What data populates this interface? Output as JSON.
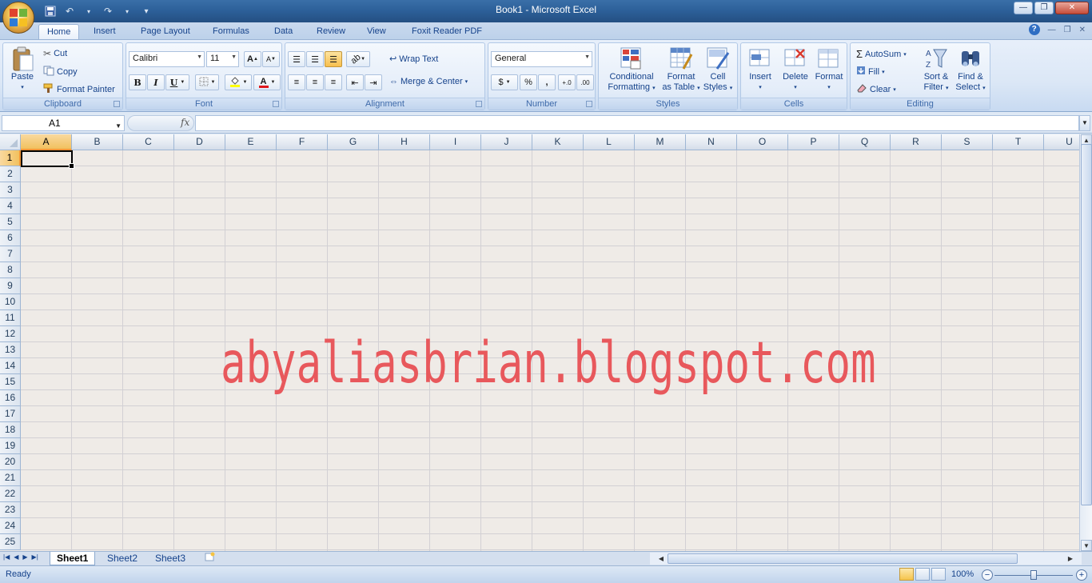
{
  "window": {
    "title": "Book1 - Microsoft Excel",
    "buttons": {
      "minimize": "—",
      "restore": "❐",
      "close": "✕"
    }
  },
  "qat": {
    "save_icon": "save-icon",
    "undo_icon": "undo-icon",
    "redo_icon": "redo-icon",
    "more": "▾"
  },
  "ribbon_tabs": [
    "Home",
    "Insert",
    "Page Layout",
    "Formulas",
    "Data",
    "Review",
    "View",
    "Foxit Reader PDF"
  ],
  "active_tab": "Home",
  "clipboard": {
    "paste": "Paste",
    "cut": "Cut",
    "copy": "Copy",
    "format_painter": "Format Painter",
    "label": "Clipboard"
  },
  "font": {
    "name": "Calibri",
    "size": "11",
    "bold": "B",
    "italic": "I",
    "underline": "U",
    "grow": "A",
    "shrink": "A",
    "font_color_glyph": "A",
    "label": "Font"
  },
  "alignment": {
    "wrap_text": "Wrap Text",
    "merge_center": "Merge & Center",
    "label": "Alignment"
  },
  "number": {
    "format": "General",
    "percent": "%",
    "comma": ",",
    "inc_decimal": "+.0\n.00",
    "dec_decimal": ".00\n→.0",
    "label": "Number"
  },
  "styles": {
    "conditional_formatting_1": "Conditional",
    "conditional_formatting_2": "Formatting",
    "format_table_1": "Format",
    "format_table_2": "as Table",
    "cell_styles_1": "Cell",
    "cell_styles_2": "Styles",
    "label": "Styles"
  },
  "cells": {
    "insert": "Insert",
    "delete": "Delete",
    "format": "Format",
    "label": "Cells"
  },
  "editing": {
    "autosum": "AutoSum",
    "fill": "Fill",
    "clear": "Clear",
    "sort_1": "Sort &",
    "sort_2": "Filter",
    "find_1": "Find &",
    "find_2": "Select",
    "label": "Editing"
  },
  "formula_bar": {
    "name_box": "A1",
    "fx": "fx",
    "value": ""
  },
  "columns": [
    "A",
    "B",
    "C",
    "D",
    "E",
    "F",
    "G",
    "H",
    "I",
    "J",
    "K",
    "L",
    "M",
    "N",
    "O",
    "P",
    "Q",
    "R",
    "S",
    "T",
    "U"
  ],
  "rows": [
    "1",
    "2",
    "3",
    "4",
    "5",
    "6",
    "7",
    "8",
    "9",
    "10",
    "11",
    "12",
    "13",
    "14",
    "15",
    "16",
    "17",
    "18",
    "19",
    "20",
    "21",
    "22",
    "23",
    "24",
    "25"
  ],
  "active_cell": {
    "col": "A",
    "row": "1"
  },
  "watermark": "abyaliasbrian.blogspot.com",
  "sheets": [
    "Sheet1",
    "Sheet2",
    "Sheet3"
  ],
  "active_sheet": "Sheet1",
  "status": {
    "text": "Ready",
    "zoom": "100%"
  },
  "colors": {
    "accent": "#15428b",
    "watermark": "#e8585c",
    "selected_header": "#f1c15f"
  }
}
